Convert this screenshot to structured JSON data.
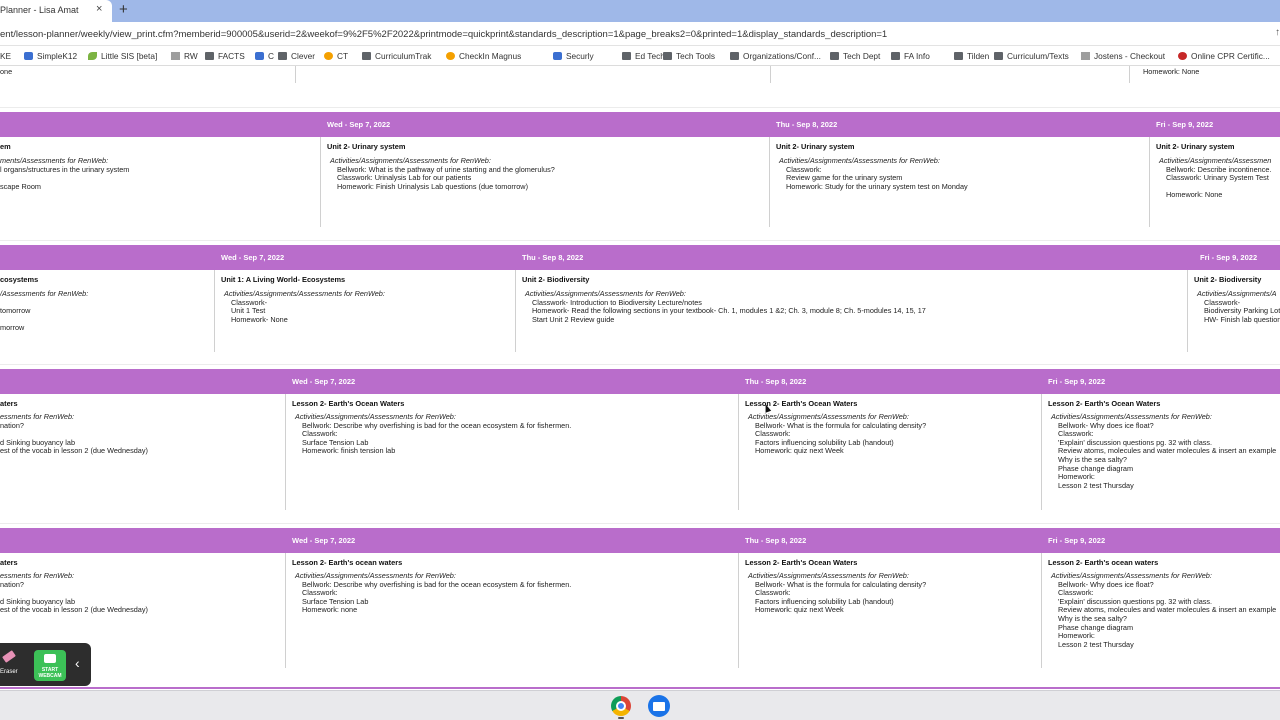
{
  "browser": {
    "tab_title": "Planner - Lisa Amat",
    "close_glyph": "×",
    "new_tab_glyph": "+",
    "url": "ent/lesson-planner/weekly/view_print.cfm?memberid=900005&userid=2&weekof=9%2F5%2F2022&printmode=quickprint&standards_description=1&page_breaks2=0&printed=1&display_standards_description=1",
    "addr_more": "↑",
    "bookmarks": [
      {
        "label": "KE",
        "icon": "none"
      },
      {
        "label": "SimpleK12",
        "icon": "sq"
      },
      {
        "label": "Little SIS [beta]",
        "icon": "lf"
      },
      {
        "label": "RW",
        "icon": "sk"
      },
      {
        "label": "FACTS",
        "icon": "folder"
      },
      {
        "label": "C",
        "icon": "sq"
      },
      {
        "label": "Clever",
        "icon": "folder"
      },
      {
        "label": "CT",
        "icon": "cf"
      },
      {
        "label": "CurriculumTrak",
        "icon": "folder"
      },
      {
        "label": "CheckIn Magnus",
        "icon": "cf"
      },
      {
        "label": "Securly",
        "icon": "sq"
      },
      {
        "label": "Ed Tech",
        "icon": "folder"
      },
      {
        "label": "Tech Tools",
        "icon": "folder"
      },
      {
        "label": "Organizations/Conf...",
        "icon": "folder"
      },
      {
        "label": "Tech Dept",
        "icon": "folder"
      },
      {
        "label": "FA Info",
        "icon": "folder"
      },
      {
        "label": "Tilden",
        "icon": "folder"
      },
      {
        "label": "Curriculum/Texts",
        "icon": "folder"
      },
      {
        "label": "Jostens - Checkout",
        "icon": "sk"
      },
      {
        "label": "Online CPR Certific...",
        "icon": "dot"
      }
    ]
  },
  "top_partial": {
    "left_text": "one",
    "right_text": "Homework: None"
  },
  "sections": [
    {
      "days": [
        "Wed - Sep 7, 2022",
        "Thu - Sep 8, 2022",
        "Fri - Sep 9, 2022"
      ],
      "columns": [
        {
          "lesson": "em",
          "lines": [
            "ments/Assessments for RenWeb:",
            "l organs/structures in the urinary system",
            "",
            "scape Room"
          ]
        },
        {
          "lesson": "Unit 2- Urinary system",
          "lines": [
            "Activities/Assignments/Assessments for RenWeb:",
            "Bellwork: What is the pathway of urine starting and the glomerulus?",
            "Classwork: Urinalysis Lab for our patients",
            "Homework: Finish Urinalysis Lab questions (due tomorrow)"
          ]
        },
        {
          "lesson": "Unit 2- Urinary system",
          "lines": [
            "Activities/Assignments/Assessments for RenWeb:",
            "Classwork:",
            "Review game for the urinary system",
            "Homework: Study for the urinary system test on Monday"
          ]
        },
        {
          "lesson": "Unit 2- Urinary system",
          "lines": [
            "Activities/Assignments/Assessmen",
            "Bellwork: Describe incontinence.",
            "Classwork: Urinary System Test",
            "",
            "Homework: None"
          ]
        }
      ]
    },
    {
      "days": [
        "Wed - Sep 7, 2022",
        "Thu - Sep 8, 2022",
        "Fri - Sep 9, 2022"
      ],
      "columns": [
        {
          "lesson": "cosystems",
          "lines": [
            "/Assessments for RenWeb:",
            "",
            "tomorrow",
            "",
            "morrow"
          ]
        },
        {
          "lesson": "Unit 1: A Living World- Ecosystems",
          "lines": [
            "Activities/Assignments/Assessments for RenWeb:",
            "Classwork-",
            "Unit 1 Test",
            "Homework- None"
          ]
        },
        {
          "lesson": "Unit 2- Biodiversity",
          "lines": [
            "Activities/Assignments/Assessments for RenWeb:",
            "Classwork- Introduction to Biodiversity Lecture/notes",
            "Homework- Read the following sections in your textbook- Ch. 1, modules 1 &2; Ch. 3, module 8; Ch. 5-modules 14, 15, 17",
            "Start Unit 2 Review guide"
          ]
        },
        {
          "lesson": "Unit 2- Biodiversity",
          "lines": [
            "Activities/Assignments/A",
            "Classwork-",
            "Biodiversity Parking Lot",
            "HW- Finish lab question"
          ]
        }
      ]
    },
    {
      "days": [
        "Wed - Sep 7, 2022",
        "Thu - Sep 8, 2022",
        "Fri - Sep 9, 2022"
      ],
      "columns": [
        {
          "lesson": "aters",
          "lines": [
            "essments for RenWeb:",
            "nation?",
            "",
            "d Sinking buoyancy lab",
            "est of the vocab in lesson 2 (due Wednesday)"
          ]
        },
        {
          "lesson": "Lesson 2- Earth's Ocean Waters",
          "lines": [
            "Activities/Assignments/Assessments for RenWeb:",
            "Bellwork: Describe why overfishing is bad for the ocean ecosystem & for fishermen.",
            "Classwork:",
            "Surface Tension Lab",
            "Homework: finish tension lab"
          ]
        },
        {
          "lesson": "Lesson 2- Earth's Ocean Waters",
          "lines": [
            "Activities/Assignments/Assessments for RenWeb:",
            "Bellwork- What is the formula for calculating density?",
            "Classwork:",
            "Factors influencing solubility Lab (handout)",
            "Homework: quiz next Week"
          ]
        },
        {
          "lesson": "Lesson 2- Earth's Ocean Waters",
          "lines": [
            "Activities/Assignments/Assessments for RenWeb:",
            "Bellwork- Why does ice float?",
            "Classwork:",
            "'Explain' discussion questions pg. 32 with class.",
            "Review atoms, molecules and water molecules & insert an example",
            "Why is the sea salty?",
            "Phase change diagram",
            "Homework:",
            "Lesson 2 test Thursday"
          ]
        }
      ]
    },
    {
      "days": [
        "Wed - Sep 7, 2022",
        "Thu - Sep 8, 2022",
        "Fri - Sep 9, 2022"
      ],
      "columns": [
        {
          "lesson": "aters",
          "lines": [
            "essments for RenWeb:",
            "nation?",
            "",
            "d Sinking buoyancy lab",
            "est of the vocab in lesson 2 (due Wednesday)"
          ]
        },
        {
          "lesson": "Lesson 2- Earth's ocean waters",
          "lines": [
            "Activities/Assignments/Assessments for RenWeb:",
            "Bellwork: Describe why overfishing is bad for the ocean ecosystem & for fishermen.",
            "Classwork:",
            "Surface Tension Lab",
            "Homework: none"
          ]
        },
        {
          "lesson": "Lesson 2- Earth's Ocean Waters",
          "lines": [
            "Activities/Assignments/Assessments for RenWeb:",
            "Bellwork- What is the formula for calculating density?",
            "Classwork:",
            "Factors influencing solubility Lab (handout)",
            "Homework: quiz next Week"
          ]
        },
        {
          "lesson": "Lesson 2- Earth's ocean waters",
          "lines": [
            "Activities/Assignments/Assessments for RenWeb:",
            "Bellwork- Why does ice float?",
            "Classwork:",
            "'Explain' discussion questions pg. 32 with class.",
            "Review atoms, molecules and water molecules & insert an example",
            "Why is the sea salty?",
            "Phase change diagram",
            "Homework:",
            "Lesson 2 test Thursday"
          ]
        }
      ]
    }
  ],
  "tool_widget": {
    "eraser_label": "Eraser",
    "webcam_line1": "START",
    "webcam_line2": "WEBCAM",
    "collapse_glyph": "‹"
  },
  "colors": {
    "day_band": "#b96dcb",
    "tab_strip": "#9fb8e8"
  }
}
